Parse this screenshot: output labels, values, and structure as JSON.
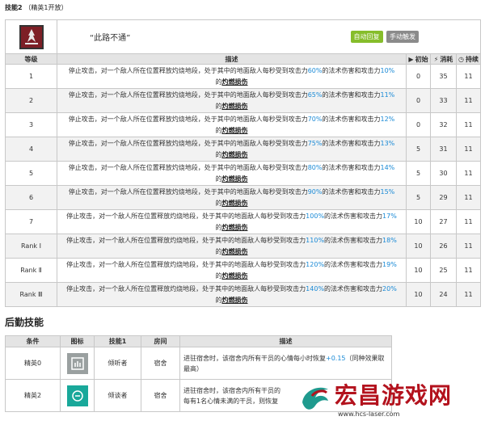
{
  "section": {
    "title": "技能2",
    "subtitle": "（精英1开放）"
  },
  "skill": {
    "name": "“此路不通”",
    "tags": [
      "自动回复",
      "手动触发"
    ]
  },
  "columns": {
    "level": "等级",
    "desc": "描述",
    "init": "初始",
    "cost": "消耗",
    "duration": "持续"
  },
  "levels": [
    {
      "level": "1",
      "pre": "停止攻击，对一个敌人所在位置释放灼烧地段，处于其中的地面敌人每秒受到攻击力",
      "pct": "60%",
      "mid": "的法术伤害和攻击力",
      "pct2": "10%",
      "post_pre": "的",
      "post": "灼燃损伤",
      "init": "0",
      "cost": "35",
      "duration": "11"
    },
    {
      "level": "2",
      "pre": "停止攻击，对一个敌人所在位置释放灼烧地段，处于其中的地面敌人每秒受到攻击力",
      "pct": "65%",
      "mid": "的法术伤害和攻击力",
      "pct2": "11%",
      "post_pre": "的",
      "post": "灼燃损伤",
      "init": "0",
      "cost": "33",
      "duration": "11"
    },
    {
      "level": "3",
      "pre": "停止攻击，对一个敌人所在位置释放灼烧地段，处于其中的地面敌人每秒受到攻击力",
      "pct": "70%",
      "mid": "的法术伤害和攻击力",
      "pct2": "12%",
      "post_pre": "的",
      "post": "灼燃损伤",
      "init": "0",
      "cost": "32",
      "duration": "11"
    },
    {
      "level": "4",
      "pre": "停止攻击，对一个敌人所在位置释放灼烧地段，处于其中的地面敌人每秒受到攻击力",
      "pct": "75%",
      "mid": "的法术伤害和攻击力",
      "pct2": "13%",
      "post_pre": "的",
      "post": "灼燃损伤",
      "init": "5",
      "cost": "31",
      "duration": "11"
    },
    {
      "level": "5",
      "pre": "停止攻击，对一个敌人所在位置释放灼烧地段，处于其中的地面敌人每秒受到攻击力",
      "pct": "80%",
      "mid": "的法术伤害和攻击力",
      "pct2": "14%",
      "post_pre": "的",
      "post": "灼燃损伤",
      "init": "5",
      "cost": "30",
      "duration": "11"
    },
    {
      "level": "6",
      "pre": "停止攻击，对一个敌人所在位置释放灼烧地段，处于其中的地面敌人每秒受到攻击力",
      "pct": "90%",
      "mid": "的法术伤害和攻击力",
      "pct2": "15%",
      "post_pre": "的",
      "post": "灼燃损伤",
      "init": "5",
      "cost": "29",
      "duration": "11"
    },
    {
      "level": "7",
      "pre": "停止攻击，对一个敌人所在位置释放灼烧地段，处于其中的地面敌人每秒受到攻击力",
      "pct": "100%",
      "mid": "的法术伤害和攻击力",
      "pct2": "17%",
      "post_pre": "的",
      "post": "灼燃损伤",
      "init": "10",
      "cost": "27",
      "duration": "11"
    },
    {
      "level": "Rank Ⅰ",
      "pre": "停止攻击，对一个敌人所在位置释放灼烧地段，处于其中的地面敌人每秒受到攻击力",
      "pct": "110%",
      "mid": "的法术伤害和攻击力",
      "pct2": "18%",
      "post_pre": "的",
      "post": "灼燃损伤",
      "init": "10",
      "cost": "26",
      "duration": "11"
    },
    {
      "level": "Rank Ⅱ",
      "pre": "停止攻击，对一个敌人所在位置释放灼烧地段，处于其中的地面敌人每秒受到攻击力",
      "pct": "120%",
      "mid": "的法术伤害和攻击力",
      "pct2": "19%",
      "post_pre": "的",
      "post": "灼燃损伤",
      "init": "10",
      "cost": "25",
      "duration": "11"
    },
    {
      "level": "Rank Ⅲ",
      "pre": "停止攻击，对一个敌人所在位置释放灼烧地段，处于其中的地面敌人每秒受到攻击力",
      "pct": "140%",
      "mid": "的法术伤害和攻击力",
      "pct2": "20%",
      "post_pre": "的",
      "post": "灼燃损伤",
      "init": "10",
      "cost": "24",
      "duration": "11"
    }
  ],
  "base": {
    "title": "后勤技能",
    "columns": {
      "cond": "条件",
      "icon": "图标",
      "skill": "技能1",
      "room": "房间",
      "desc": "描述"
    },
    "rows": [
      {
        "cond": "精英0",
        "skill": "倾听者",
        "room": "宿舍",
        "desc_pre": "进驻宿舍时，该宿舍内所有干员的心情每小时恢复",
        "val": "+0.15",
        "desc_post": "（同种效果取最高）"
      },
      {
        "cond": "精英2",
        "skill": "倾谈者",
        "room": "宿舍",
        "desc_pre": "进驻宿舍时，该宿舍内所有干员的",
        "val": "",
        "desc_post": "每有1名心情未满的干员，则恢复"
      }
    ]
  },
  "watermark": {
    "brand": "宏昌游戏网",
    "url": "www.hcs-laser.com"
  },
  "colors": {
    "highlight": "#1a8ad6",
    "tag_auto": "#86bd2b",
    "tag_manual": "#8b8b8b",
    "brand_red": "#b3121d"
  }
}
